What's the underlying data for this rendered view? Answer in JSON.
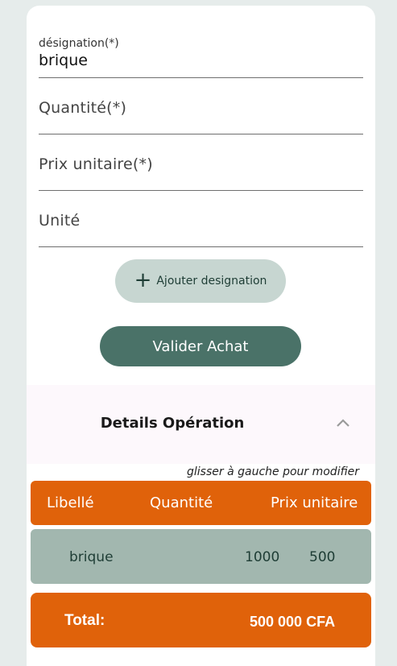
{
  "form": {
    "designation": {
      "label": "désignation(*)",
      "value": "brique"
    },
    "quantite": {
      "placeholder": "Quantité(*)"
    },
    "prix_unitaire": {
      "placeholder": "Prix unitaire(*)"
    },
    "unite": {
      "placeholder": "Unité"
    }
  },
  "buttons": {
    "add_label": "Ajouter designation",
    "add_icon": "plus-icon",
    "validate_label": "Valider Achat"
  },
  "details": {
    "title": "Details Opération",
    "chevron_icon": "chevron-up-icon",
    "hint": "glisser à gauche pour modifier"
  },
  "table": {
    "headers": [
      "Libellé",
      "Quantité",
      "Prix unitaire"
    ],
    "rows": [
      {
        "libelle": "brique",
        "quantite": "1000",
        "prix": "500"
      }
    ]
  },
  "total": {
    "label": "Total:",
    "amount": "500 000 CFA"
  },
  "colors": {
    "accent_orange": "#e0620a",
    "primary_green": "#4a7268",
    "light_green": "#c7d6d1",
    "row_green": "#a2b7af"
  }
}
